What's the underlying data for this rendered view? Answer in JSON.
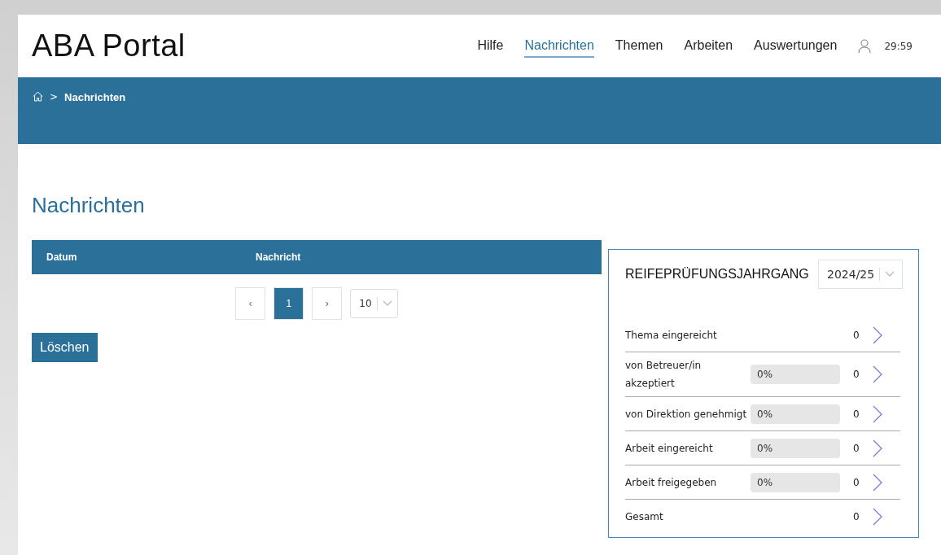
{
  "header": {
    "logo": "ABA Portal",
    "nav": [
      {
        "label": "Hilfe",
        "selected": false
      },
      {
        "label": "Nachrichten",
        "selected": true
      },
      {
        "label": "Themen",
        "selected": false
      },
      {
        "label": "Arbeiten",
        "selected": false
      },
      {
        "label": "Auswertungen",
        "selected": false
      }
    ],
    "timer": "29:59"
  },
  "breadcrumb": {
    "separator": ">",
    "current": "Nachrichten"
  },
  "page_title": "Nachrichten",
  "table": {
    "columns": [
      "Datum",
      "Nachricht"
    ]
  },
  "pagination": {
    "prev": "‹",
    "pages": [
      {
        "label": "1",
        "selected": true
      }
    ],
    "next": "›",
    "page_size": "10"
  },
  "delete_button": "Löschen",
  "panel": {
    "title": "REIFEPRÜFUNGSJAHRGANG",
    "year": "2024/25",
    "rows": [
      {
        "kind": "count",
        "label": "Thema eingereicht",
        "count": "0"
      },
      {
        "kind": "progress",
        "label": "von Betreuer/in akzeptiert",
        "level": 0,
        "percent": "0%",
        "count": "0"
      },
      {
        "kind": "progress",
        "label": "von Direktion genehmigt",
        "level": 0,
        "percent": "0%",
        "count": "0"
      },
      {
        "kind": "progress",
        "label": "Arbeit eingereicht",
        "level": 0,
        "percent": "0%",
        "count": "0"
      },
      {
        "kind": "progress",
        "label": "Arbeit freigegeben",
        "level": 0,
        "percent": "0%",
        "count": "0"
      },
      {
        "kind": "count",
        "label": "Gesamt",
        "count": "0"
      }
    ]
  }
}
